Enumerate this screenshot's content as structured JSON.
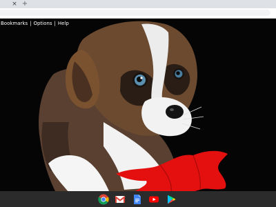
{
  "browser": {
    "tab_close_glyph": "×",
    "new_tab_glyph": "+"
  },
  "ntp_links": {
    "bookmarks": "Bookmarks",
    "separator": "|",
    "options": "Options",
    "help": "Help"
  },
  "shelf": {
    "apps": [
      {
        "icon": "chrome-icon"
      },
      {
        "icon": "gmail-icon"
      },
      {
        "icon": "docs-icon"
      },
      {
        "icon": "youtube-icon"
      },
      {
        "icon": "play-store-icon"
      }
    ]
  },
  "colors": {
    "tabstrip": "#dee1e6",
    "toolbar": "#ffffff",
    "shelf": "#2b2b2b",
    "background": "#050505"
  }
}
